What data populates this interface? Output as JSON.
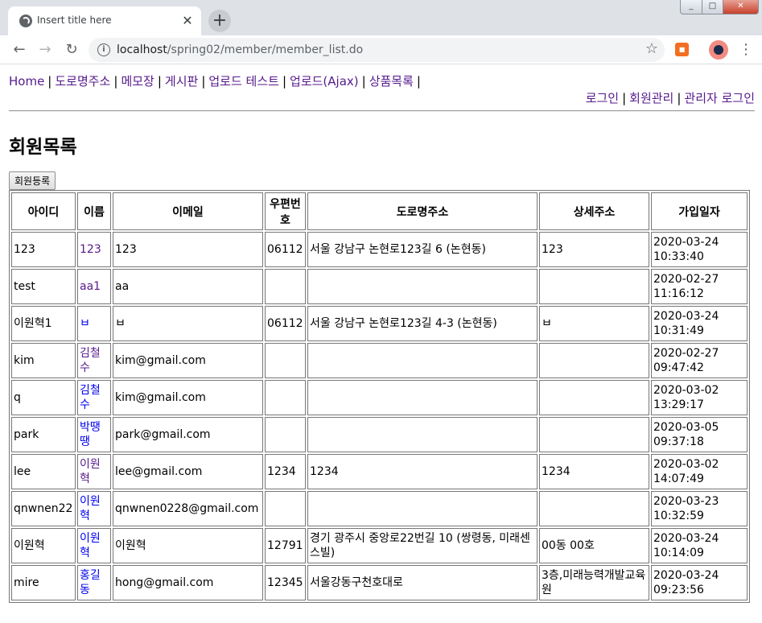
{
  "browser": {
    "tab_title": "Insert title here",
    "tab_close": "✕",
    "new_tab": "+",
    "url_host": "localhost",
    "url_path": "/spring02/member/member_list.do",
    "window_min": "_",
    "window_max": "□",
    "window_close": "✕"
  },
  "nav": {
    "items": [
      "Home",
      "도로명주소",
      "메모장",
      "게시판",
      "업로드 테스트",
      "업로드(Ajax)",
      "상품목록"
    ],
    "right_items": [
      "로그인",
      "회원관리",
      "관리자 로그인"
    ]
  },
  "page": {
    "title": "회원목록",
    "register_button": "회원등록"
  },
  "table": {
    "headers": [
      "아이디",
      "이름",
      "이메일",
      "우편번호",
      "도로명주소",
      "상세주소",
      "가입일자"
    ],
    "rows": [
      {
        "id": "123",
        "name": "123",
        "email": "123",
        "zip": "06112",
        "address": "서울 강남구 논현로123길 6 (논현동)",
        "detail": "123",
        "date": "2020-03-24 10:33:40",
        "visited": true
      },
      {
        "id": "test",
        "name": "aa1",
        "email": "aa",
        "zip": "",
        "address": "",
        "detail": "",
        "date": "2020-02-27 11:16:12",
        "visited": true
      },
      {
        "id": "이원혁1",
        "name": "ㅂ",
        "email": "ㅂ",
        "zip": "06112",
        "address": "서울 강남구 논현로123길 4-3 (논현동)",
        "detail": "ㅂ",
        "date": "2020-03-24 10:31:49",
        "visited": false
      },
      {
        "id": "kim",
        "name": "김철수",
        "email": "kim@gmail.com",
        "zip": "",
        "address": "",
        "detail": "",
        "date": "2020-02-27 09:47:42",
        "visited": true
      },
      {
        "id": "q",
        "name": "김철수",
        "email": "kim@gmail.com",
        "zip": "",
        "address": "",
        "detail": "",
        "date": "2020-03-02 13:29:17",
        "visited": false
      },
      {
        "id": "park",
        "name": "박땡땡",
        "email": "park@gmail.com",
        "zip": "",
        "address": "",
        "detail": "",
        "date": "2020-03-05 09:37:18",
        "visited": false
      },
      {
        "id": "lee",
        "name": "이원혁",
        "email": "lee@gmail.com",
        "zip": "1234",
        "address": "1234",
        "detail": "1234",
        "date": "2020-03-02 14:07:49",
        "visited": true
      },
      {
        "id": "qnwnen22",
        "name": "이원혁",
        "email": "qnwnen0228@gmail.com",
        "zip": "",
        "address": "",
        "detail": "",
        "date": "2020-03-23 10:32:59",
        "visited": false
      },
      {
        "id": "이원혁",
        "name": "이원혁",
        "email": "이원혁",
        "zip": "12791",
        "address": "경기 광주시 중앙로22번길 10 (쌍령동, 미래센스빌)",
        "detail": "00동 00호",
        "date": "2020-03-24 10:14:09",
        "visited": false
      },
      {
        "id": "mire",
        "name": "홍길동",
        "email": "hong@gmail.com",
        "zip": "12345",
        "address": "서울강동구천호대로",
        "detail": "3층,미래능력개발교육원",
        "date": "2020-03-24 09:23:56",
        "visited": false
      }
    ]
  },
  "colors": {
    "visited_link": "#551a8b",
    "unvisited_link": "#0000ee"
  }
}
